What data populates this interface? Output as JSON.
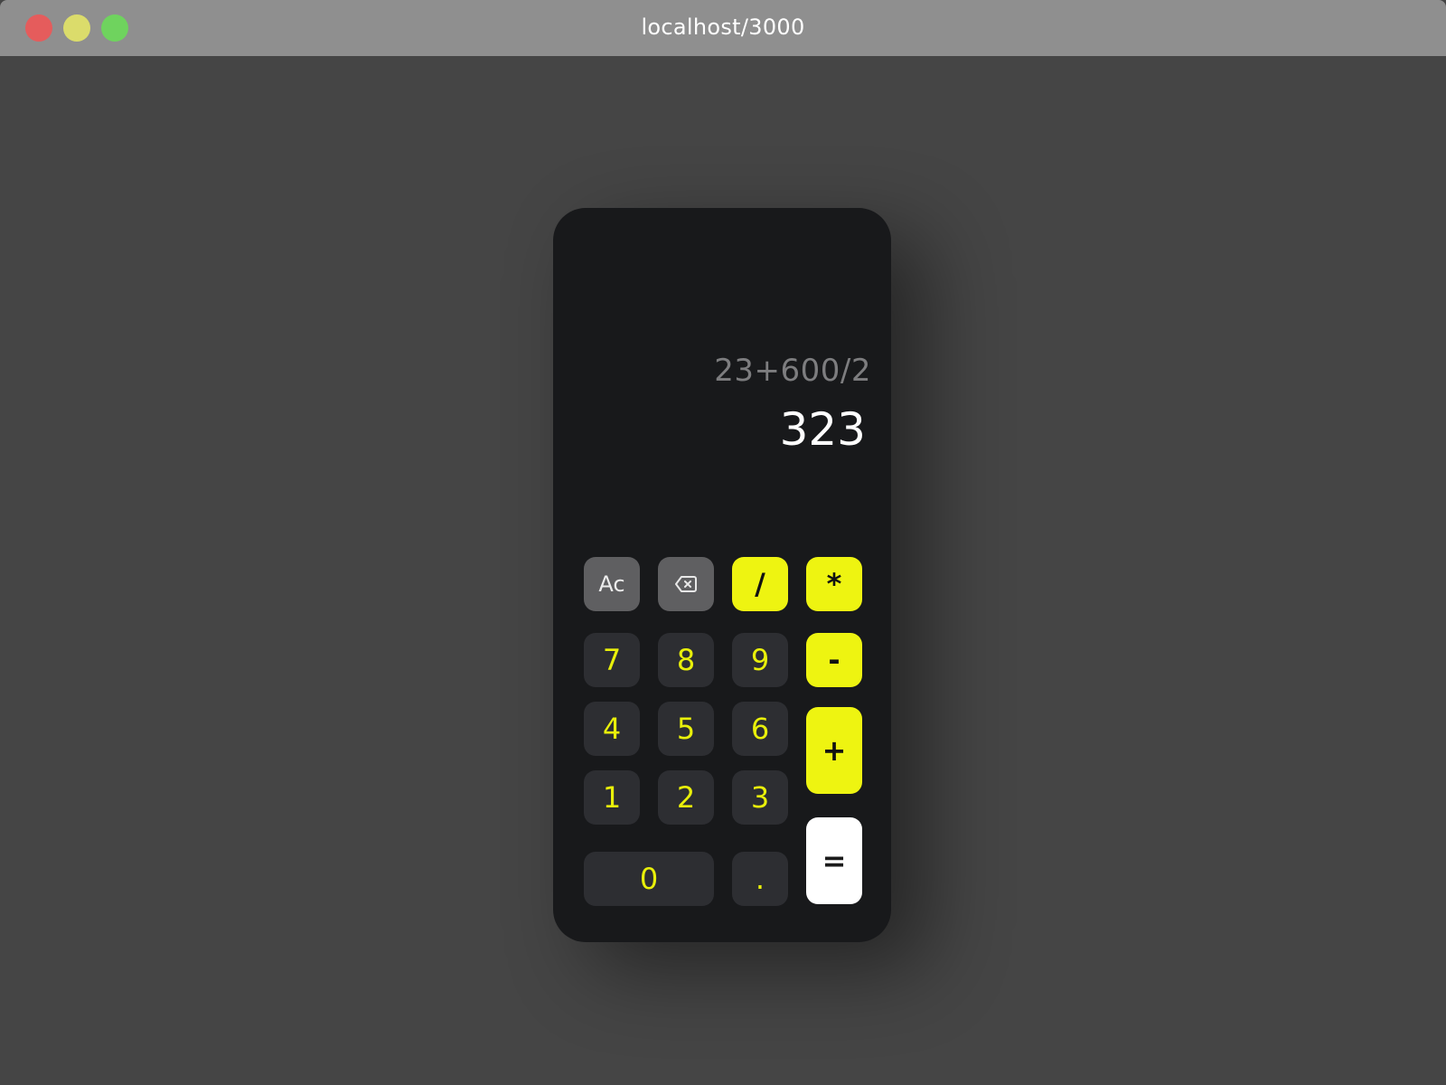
{
  "browser": {
    "url": "localhost/3000"
  },
  "display": {
    "expression": "23+600/2",
    "result": "323"
  },
  "keys": {
    "clear": "Ac",
    "divide": "/",
    "multiply": "*",
    "seven": "7",
    "eight": "8",
    "nine": "9",
    "minus": "-",
    "four": "4",
    "five": "5",
    "six": "6",
    "plus": "+",
    "one": "1",
    "two": "2",
    "three": "3",
    "equals": "=",
    "zero": "0",
    "decimal": "."
  },
  "icons": {
    "backspace": "backspace-icon"
  },
  "colors": {
    "accent": "#eef411",
    "digit_text": "#e9f00a",
    "calculator_body": "#18191b",
    "digit_key": "#2d2e32",
    "function_key": "#5f5f61",
    "page_background": "#454545",
    "titlebar": "#8f8f8f"
  }
}
